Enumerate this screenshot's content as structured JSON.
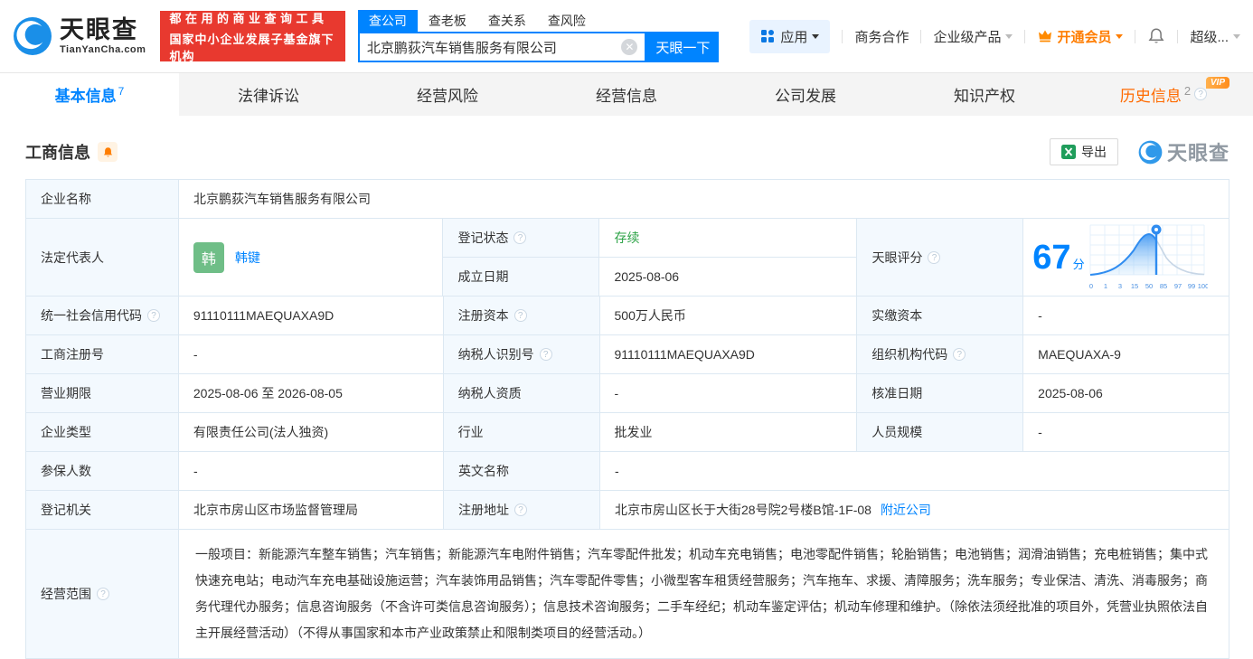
{
  "colors": {
    "accent": "#0084ff",
    "orange": "#ff7d00",
    "status_green": "#2ba245",
    "banner_red": "#e8392f"
  },
  "header": {
    "brand": "天眼查",
    "brand_domain": "TianYanCha.com",
    "slogan_line1": "都在用的商业查询工具",
    "slogan_line2": "国家中小企业发展子基金旗下机构",
    "search_tabs": [
      {
        "label": "查公司"
      },
      {
        "label": "查老板"
      },
      {
        "label": "查关系"
      },
      {
        "label": "查风险"
      }
    ],
    "search_value": "北京鹏荻汽车销售服务有限公司",
    "search_button": "天眼一下",
    "nav_apps": "应用",
    "nav_biz": "商务合作",
    "nav_enterprise": "企业级产品",
    "nav_vip": "开通会员",
    "nav_super": "超级..."
  },
  "tabs": {
    "basic": {
      "label": "基本信息",
      "count": "7"
    },
    "legal": {
      "label": "法律诉讼"
    },
    "risk": {
      "label": "经营风险"
    },
    "operating": {
      "label": "经营信息"
    },
    "development": {
      "label": "公司发展"
    },
    "ip": {
      "label": "知识产权"
    },
    "history": {
      "label": "历史信息",
      "count": "2",
      "vip": "VIP"
    }
  },
  "section": {
    "title": "工商信息",
    "export_label": "导出",
    "watermark": "天眼查"
  },
  "info": {
    "company_name_label": "企业名称",
    "company_name": "北京鹏荻汽车销售服务有限公司",
    "legal_rep_label": "法定代表人",
    "legal_rep_avatar": "韩",
    "legal_rep_name": "韩键",
    "reg_status_label": "登记状态",
    "reg_status": "存续",
    "est_date_label": "成立日期",
    "est_date": "2025-08-06",
    "score_label": "天眼评分",
    "score": "67",
    "score_unit": "分"
  },
  "grid_rows": [
    [
      {
        "label": "统一社会信用代码",
        "value": "91110111MAEQUAXA9D"
      },
      {
        "label": "注册资本",
        "value": "500万人民币"
      },
      {
        "label": "实缴资本",
        "value": "-"
      }
    ],
    [
      {
        "label": "工商注册号",
        "value": "-"
      },
      {
        "label": "纳税人识别号",
        "value": "91110111MAEQUAXA9D"
      },
      {
        "label": "组织机构代码",
        "value": "MAEQUAXA-9"
      }
    ],
    [
      {
        "label": "营业期限",
        "value": "2025-08-06 至 2026-08-05"
      },
      {
        "label": "纳税人资质",
        "value": "-"
      },
      {
        "label": "核准日期",
        "value": "2025-08-06"
      }
    ],
    [
      {
        "label": "企业类型",
        "value": "有限责任公司(法人独资)"
      },
      {
        "label": "行业",
        "value": "批发业"
      },
      {
        "label": "人员规模",
        "value": "-"
      }
    ],
    [
      {
        "label": "参保人数",
        "value": "-"
      },
      {
        "label": "英文名称",
        "value": "-"
      }
    ],
    [
      {
        "label": "登记机关",
        "value": "北京市房山区市场监督管理局"
      },
      {
        "label": "注册地址",
        "value": "北京市房山区长于大街28号院2号楼B馆-1F-08",
        "link": "附近公司"
      }
    ]
  ],
  "scope": {
    "label": "经营范围",
    "value": "一般项目：新能源汽车整车销售；汽车销售；新能源汽车电附件销售；汽车零配件批发；机动车充电销售；电池零配件销售；轮胎销售；电池销售；润滑油销售；充电桩销售；集中式快速充电站；电动汽车充电基础设施运营；汽车装饰用品销售；汽车零配件零售；小微型客车租赁经营服务；汽车拖车、求援、清障服务；洗车服务；专业保洁、清洗、消毒服务；商务代理代办服务；信息咨询服务（不含许可类信息咨询服务）；信息技术咨询服务；二手车经纪；机动车鉴定评估；机动车修理和维护。（除依法须经批准的项目外，凭营业执照依法自主开展经营活动）（不得从事国家和本市产业政策禁止和限制类项目的经营活动。）"
  },
  "score_chart": {
    "type": "area",
    "ticks": [
      "0",
      "1",
      "3",
      "15",
      "50",
      "85",
      "97",
      "99",
      "100"
    ],
    "marker_score": 67
  }
}
